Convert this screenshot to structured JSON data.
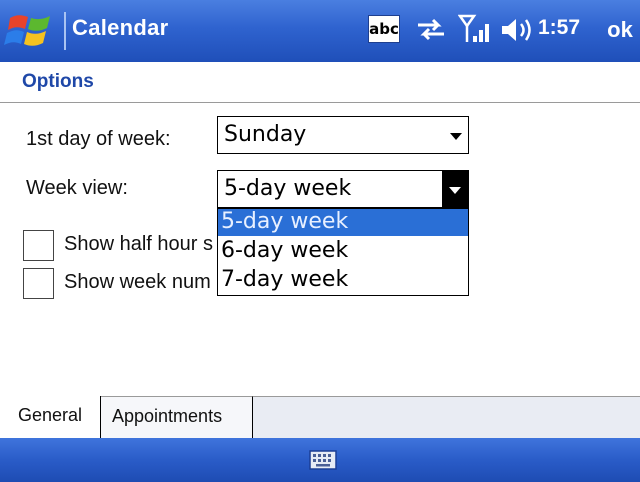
{
  "titlebar": {
    "app_title": "Calendar",
    "input_method": "abc",
    "time": "1:57",
    "ok_label": "ok",
    "icons": [
      "windows-start-icon",
      "connectivity-icon",
      "signal-icon",
      "volume-icon"
    ]
  },
  "options": {
    "header": "Options",
    "first_day_label": "1st day of week:",
    "first_day_value": "Sunday",
    "week_view_label": "Week view:",
    "week_view_value": "5-day week",
    "week_view_options": [
      "5-day week",
      "6-day week",
      "7-day week"
    ],
    "week_view_selected_index": 0,
    "half_hour_label": "Show half hour s",
    "half_hour_checked": false,
    "week_num_label": "Show week num",
    "week_num_checked": false
  },
  "tabs": {
    "items": [
      "General",
      "Appointments"
    ],
    "active": "General"
  },
  "bottombar": {
    "icons": [
      "keyboard-icon"
    ]
  },
  "colors": {
    "titlebar": "#2f63cf",
    "header_text": "#1f48a8",
    "selection": "#2a6fd6"
  }
}
